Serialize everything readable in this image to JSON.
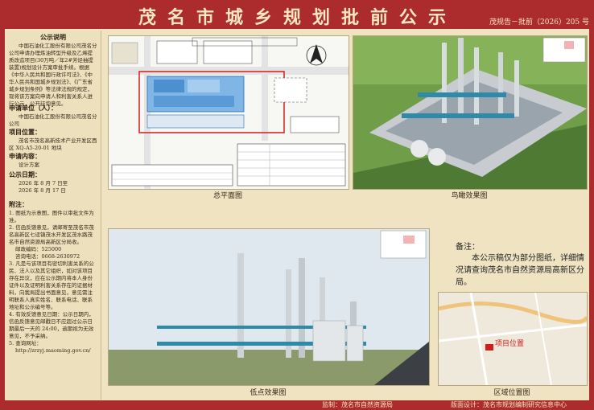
{
  "header": {
    "title": "茂名市城乡规划批前公示",
    "doc_no": "茂规告－批前（2026）205 号"
  },
  "left": {
    "notice_title": "公示说明",
    "notice_text": "中国石油化工股份有限公司茂名分公司申请办理炼油转型升级及乙烯提质改造项目(30万吨／年2#芳烃抽提装置)规划设计方案审批手续。根据《中华人民共和国行政许可法》、《中华人民共和国城乡规划法》、《广东省城乡规划条例》等法律法规的规定，现将该方案向申请人和利害关系人进行公示，公开征询意见。",
    "applicant_label": "申请单位（人）：",
    "applicant": "中国石油化工股份有限公司茂名分公司",
    "project_label": "项目位置：",
    "project": "茂名市茂名高新技术产业开发区西区 XQ-A5-20-01 地块",
    "content_label": "申请内容：",
    "content": "设计方案",
    "period_label": "公示日期：",
    "period_start": "2026 年 8 月 7 日至",
    "period_end": "2026 年 8 月 17 日",
    "appendix_label": "附注：",
    "appendix": [
      "1. 图纸为示意图，图件以审批文件为准。",
      "2. 信函反馈意见，请邮寄至茂名市茂名高新区七迳镇茂水开发区茂水路茂名市自然资源局高新区分局收。",
      "邮政编码：525000",
      "咨询电话：0668-2630972",
      "3. 凡是与该项目有密切利害关系的公民、法人以及其它组织，如对该项目存在异议，应在公示期内将本人身份证件以及证明利害关系存在的证据材料，向我局提出书面意见，意见需注明联系人真实姓名、联系电话、联系地址和公示编号等。",
      "4. 有效反馈意见日期：公示日期内，信函反馈意见邮戳日不应超过公示日期最后一天的 24:00，逾期视为无效意见，不予采纳。",
      "5. 查询网址：",
      "http://zrzyj.maoming.gov.cn/"
    ]
  },
  "captions": {
    "plan": "总平面图",
    "aerial": "鸟瞰效果图",
    "low": "低点效果图",
    "location": "区域位置图"
  },
  "note": {
    "title": "备注：",
    "text": "本公示稿仅为部分图纸，详细情况请查询茂名市自然资源局高新区分局。"
  },
  "map": {
    "marker": "项目位置"
  },
  "footer": {
    "supervise": "监制：茂名市自然资源局",
    "design": "版面设计：茂名市规划编制研究信息中心"
  },
  "colors": {
    "brand_red": "#ac2b2c",
    "board": "#efe3c2",
    "title_text": "#f6e7c1"
  }
}
